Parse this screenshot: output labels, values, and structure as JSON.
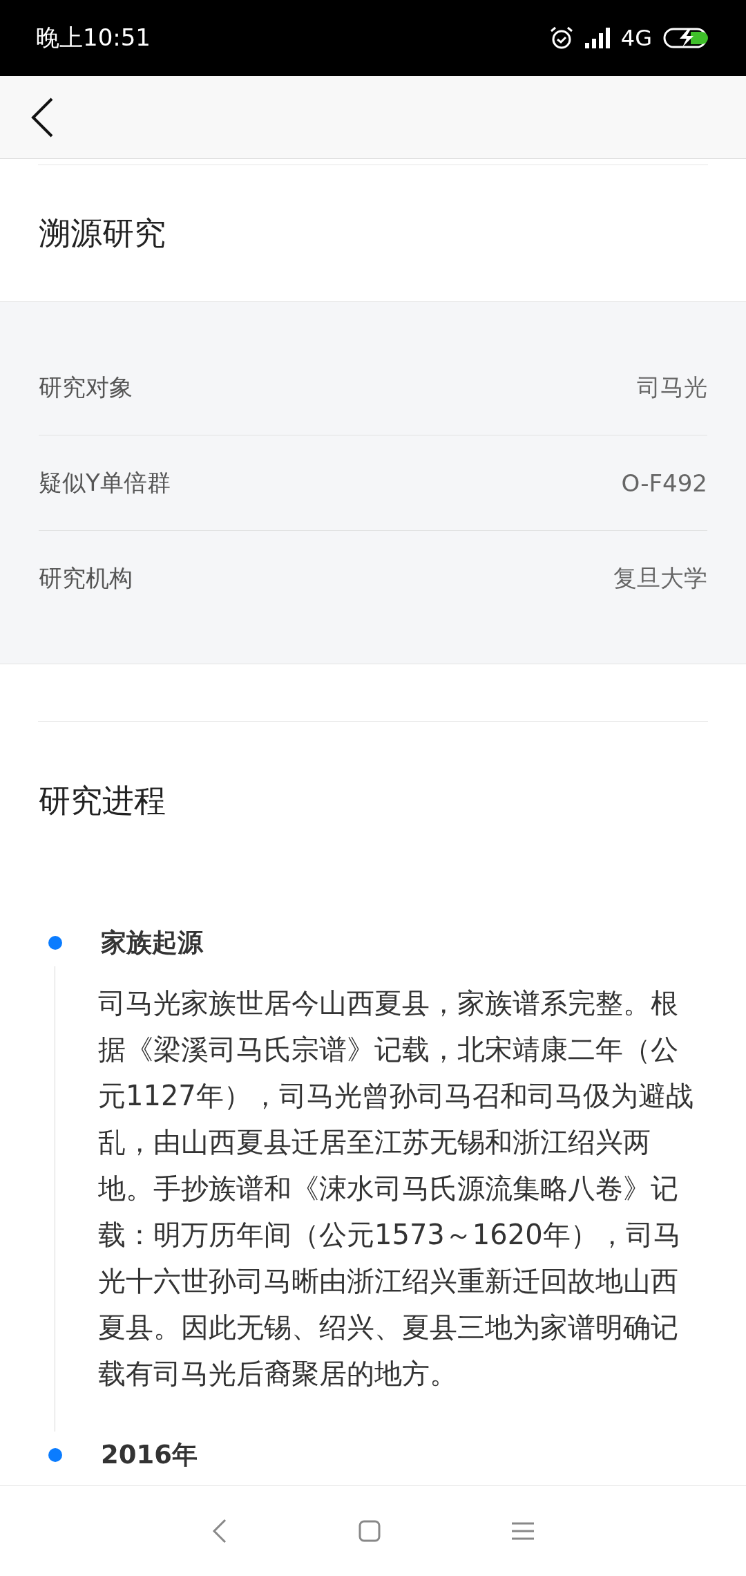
{
  "status_bar": {
    "time": "晚上10:51",
    "network": "4G"
  },
  "sections": [
    {
      "title": "溯源研究"
    }
  ],
  "info_rows": [
    {
      "label": "研究对象",
      "value": "司马光"
    },
    {
      "label": "疑似Y单倍群",
      "value": "O-F492"
    },
    {
      "label": "研究机构",
      "value": "复旦大学"
    }
  ],
  "progress": {
    "title": "研究进程",
    "items": [
      {
        "title": "家族起源",
        "body": "司马光家族世居今山西夏县，家族谱系完整。根据《梁溪司马氏宗谱》记载，北宋靖康二年（公元1127年），司马光曾孙司马召和司马伋为避战乱，由山西夏县迁居至江苏无锡和浙江绍兴两地。手抄族谱和《涑水司马氏源流集略八卷》记载：明万历年间（公元1573～1620年），司马光十六世孙司马晰由浙江绍兴重新迁回故地山西夏县。因此无锡、绍兴、夏县三地为家谱明确记载有司马光后裔聚居的地方。"
      },
      {
        "title": "2016年"
      }
    ]
  }
}
